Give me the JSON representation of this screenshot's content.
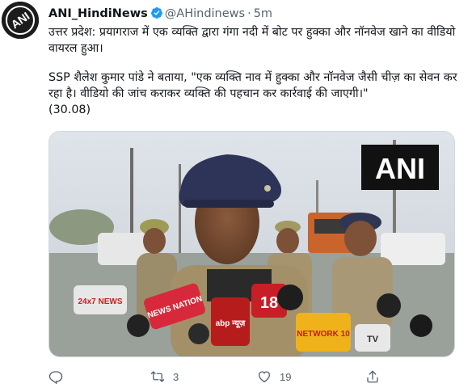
{
  "tweet": {
    "author_name": "ANI_HindiNews",
    "author_handle": "@AHindinews",
    "separator": "·",
    "time": "5m",
    "avatar_logo_text": "ANI",
    "text_line_1": "उत्तर प्रदेश: प्रयागराज में एक व्यक्ति द्वारा गंगा नदी में बोट पर हुक्का और नॉनवेज खाने का वीडियो वायरल हुआ।",
    "text_line_2": "SSP शैलेश कुमार पांडे ने बताया, \"एक व्यक्ति नाव में हुक्का और नॉनवेज जैसी चीज़ का सेवन कर रहा है। वीडियो की जांच कराकर व्यक्ति की पहचान कर कार्रवाई की जाएगी।\"",
    "text_line_3": "(30.08)"
  },
  "media": {
    "watermark": "ANI",
    "mic_labels": [
      "24x7 NEWS",
      "NEWS NATION",
      "abp न्यूज़",
      "18",
      "NETWORK 10",
      "TV"
    ]
  },
  "actions": {
    "reply_count": "",
    "retweet_count": "3",
    "like_count": "19",
    "icons": [
      "reply-icon",
      "retweet-icon",
      "like-icon",
      "share-icon"
    ]
  },
  "colors": {
    "text": "#0f1419",
    "secondary": "#536471",
    "verified": "#1d9bf0",
    "watermark_bg": "#111111"
  }
}
